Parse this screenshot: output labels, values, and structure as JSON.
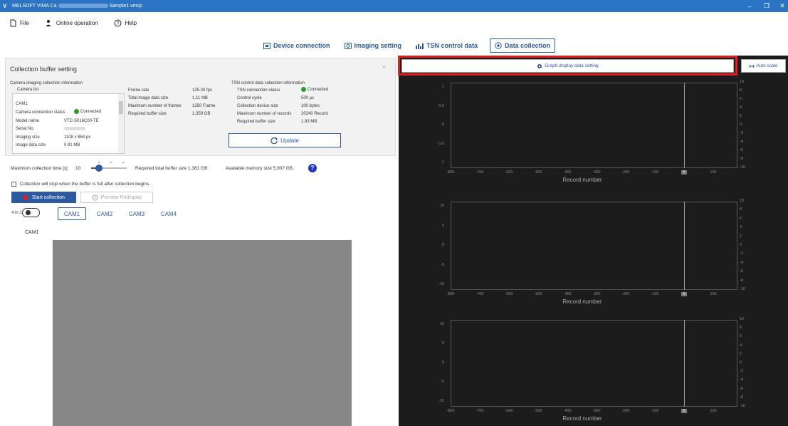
{
  "window": {
    "title_prefix": "MELSOFT VIMA Ca",
    "title_suffix": "Sample1.vmcp"
  },
  "menu": {
    "file": "File",
    "online": "Online operation",
    "help": "Help"
  },
  "tabs": {
    "device": "Device connection",
    "imaging": "Imaging setting",
    "tsn": "TSN control data",
    "collection": "Data collection"
  },
  "buffer": {
    "title": "Collection buffer setting",
    "cam_heading": "Camera imaging collection information",
    "cam_list_label": "Camera list",
    "cam_name": "CAM1",
    "cam_rows": [
      {
        "label": "Camera connection status",
        "value": "Connected"
      },
      {
        "label": "Model name",
        "value": "VTC-S016C00-TE"
      },
      {
        "label": "Serial No.",
        "value": ""
      },
      {
        "label": "Imaging size",
        "value": "1108 x 864 px"
      },
      {
        "label": "Image data size",
        "value": "0.91 MB"
      }
    ],
    "frame_rows": [
      {
        "label": "Frame rate",
        "value": "125.00 fps"
      },
      {
        "label": "Total image data size",
        "value": "1.11 MB"
      },
      {
        "label": "Maximum number of frames",
        "value": "1250 Frame"
      },
      {
        "label": "Required buffer size",
        "value": "1.359 GB"
      }
    ],
    "tsn_heading": "TSN control data collection information",
    "tsn_rows": [
      {
        "label": "TSN connection status",
        "value": "Connected"
      },
      {
        "label": "Control cycle",
        "value": "500 μs"
      },
      {
        "label": "Collection device size",
        "value": "100 bytes"
      },
      {
        "label": "Maximum number of records",
        "value": "20240 Record"
      },
      {
        "label": "Required buffer size",
        "value": "1.93 MB"
      }
    ],
    "update_label": "Update"
  },
  "collection": {
    "max_time_label": "Maximum collection time [s]",
    "max_time_value": "10",
    "max_time_level": 0.15,
    "required_total": "Required total buffer size 1.361 GB",
    "available_memory": "Available memory size 5.907 GB",
    "stop_checkbox_label": "Collection will stop when the buffer is full after collection begins.",
    "start_label": "Start collection",
    "preview_label": "Preview Redisplay",
    "four_in_one_label": "4 in 1",
    "cam_tabs": [
      "CAM1",
      "CAM2",
      "CAM3",
      "CAM4"
    ],
    "view_label": "CAM1"
  },
  "graph_panel": {
    "setting_label": "Graph display data setting",
    "autoscale_label": "Auto scale",
    "xlabel": "Record number",
    "xticks": [
      "-800",
      "-700",
      "-600",
      "-500",
      "-400",
      "-300",
      "-200",
      "-100",
      "0",
      "100"
    ],
    "graph1_left_ticks": [
      "1",
      "0.5",
      "0",
      "-0.5",
      "-1"
    ],
    "graph_left_ticks": [
      "10",
      "5",
      "0",
      "-5",
      "-10"
    ],
    "right_ticks": [
      "10",
      "8",
      "6",
      "4",
      "2",
      "0",
      "-2",
      "-4",
      "-6",
      "-8",
      "-10"
    ]
  },
  "colors": {
    "titlebar": "#2b74c4",
    "accent": "#2c5aa0",
    "highlight": "#e02020",
    "connected": "#2a9d2a",
    "graph_bg": "#1c1c1c"
  }
}
